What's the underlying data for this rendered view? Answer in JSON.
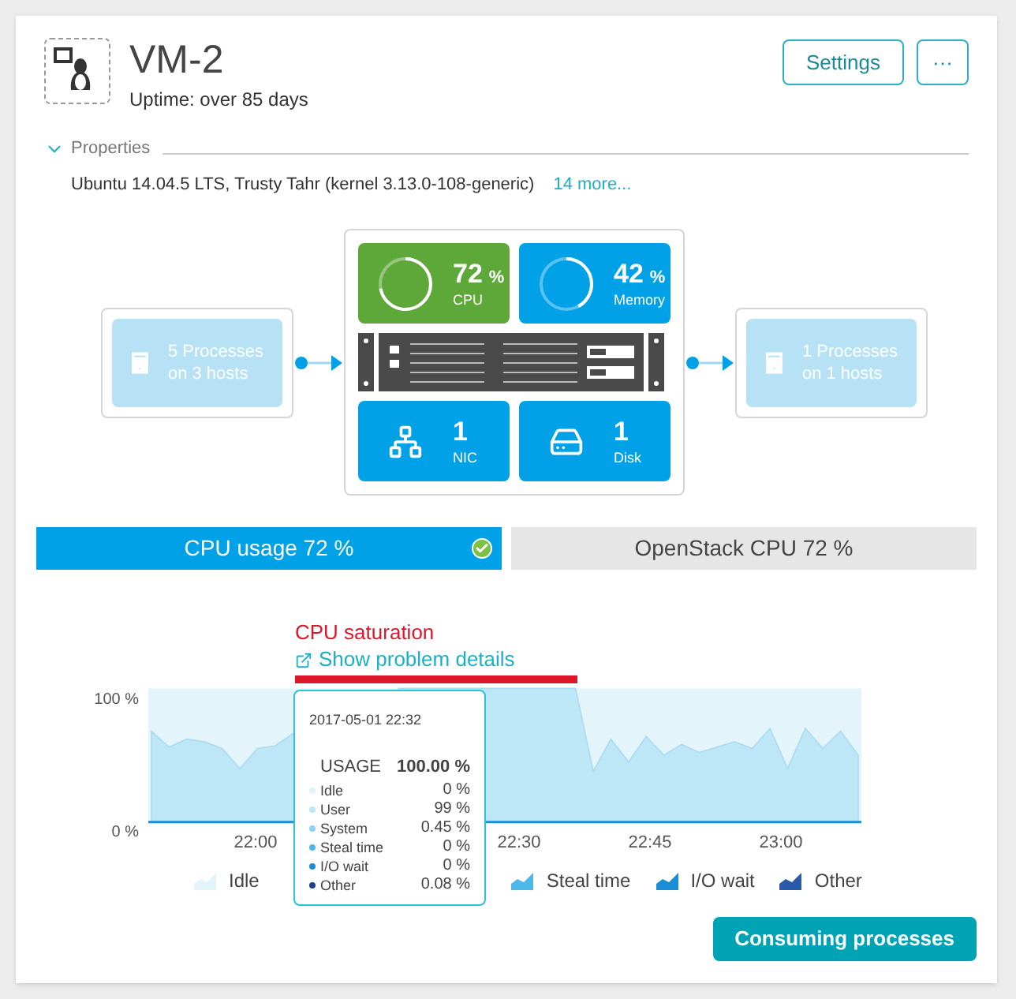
{
  "header": {
    "title": "VM-2",
    "subtitle": "Uptime: over 85 days",
    "buttons": [
      {
        "label": "Settings"
      },
      {
        "label": "···"
      }
    ]
  },
  "properties": {
    "label": "Properties",
    "expanded": true,
    "summary": "Ubuntu 14.04.5 LTS, Trusty Tahr (kernel 3.13.0-108-generic)",
    "more_link": "14 more..."
  },
  "diagram": {
    "inbound": {
      "line_1": "5 Processes",
      "line_2": "on 3 hosts"
    },
    "metrics": [
      {
        "kind": "ring",
        "value": "72",
        "unit": "%",
        "label": "CPU",
        "level": 0.72,
        "color": "#5ea83a"
      },
      {
        "kind": "ring",
        "value": "42",
        "unit": "%",
        "label": "Memory",
        "level": 0.42,
        "color": "#00a1e6"
      },
      {
        "kind": "network",
        "value": "1",
        "label": "NIC",
        "color": "#00a1e6"
      },
      {
        "kind": "disk",
        "value": "1",
        "label": "Disk",
        "color": "#00a1e6"
      }
    ],
    "outbound": {
      "line_1": "1 Processes",
      "line_2": "on 1 hosts"
    }
  },
  "tabs": [
    {
      "label": "CPU usage 72 %",
      "selected": true
    },
    {
      "label": "OpenStack CPU 72 %",
      "selected": false
    }
  ],
  "problem": {
    "title": "CPU saturation",
    "link": "Show problem details"
  },
  "chart": {
    "y_axis_labels": [
      "100 %",
      "0 %"
    ],
    "x_axis_labels": [
      "22:00",
      "22:30",
      "22:45",
      "23:00"
    ]
  },
  "legend": [
    {
      "label": "Idle",
      "color": "#e3f4fb"
    },
    {
      "label": "Steal time",
      "color": "#4fb8ea"
    },
    {
      "label": "I/O wait",
      "color": "#1a8fd8"
    },
    {
      "label": "Other",
      "color": "#2a5aa8"
    }
  ],
  "tooltip": {
    "time": "2017-05-01 22:32",
    "total_label": "USAGE",
    "total_value": "100.00 %",
    "rows": [
      {
        "label": "Idle",
        "value": "0 %",
        "color": "#e3f4fb"
      },
      {
        "label": "User",
        "value": "99 %",
        "color": "#bde6f7"
      },
      {
        "label": "System",
        "value": "0.45 %",
        "color": "#8ed3f0"
      },
      {
        "label": "Steal time",
        "value": "0 %",
        "color": "#4fb8ea"
      },
      {
        "label": "I/O wait",
        "value": "0 %",
        "color": "#1a8fd8"
      },
      {
        "label": "Other",
        "value": "0.08 %",
        "color": "#1c3f8e"
      }
    ]
  },
  "action_button": "Consuming processes"
}
